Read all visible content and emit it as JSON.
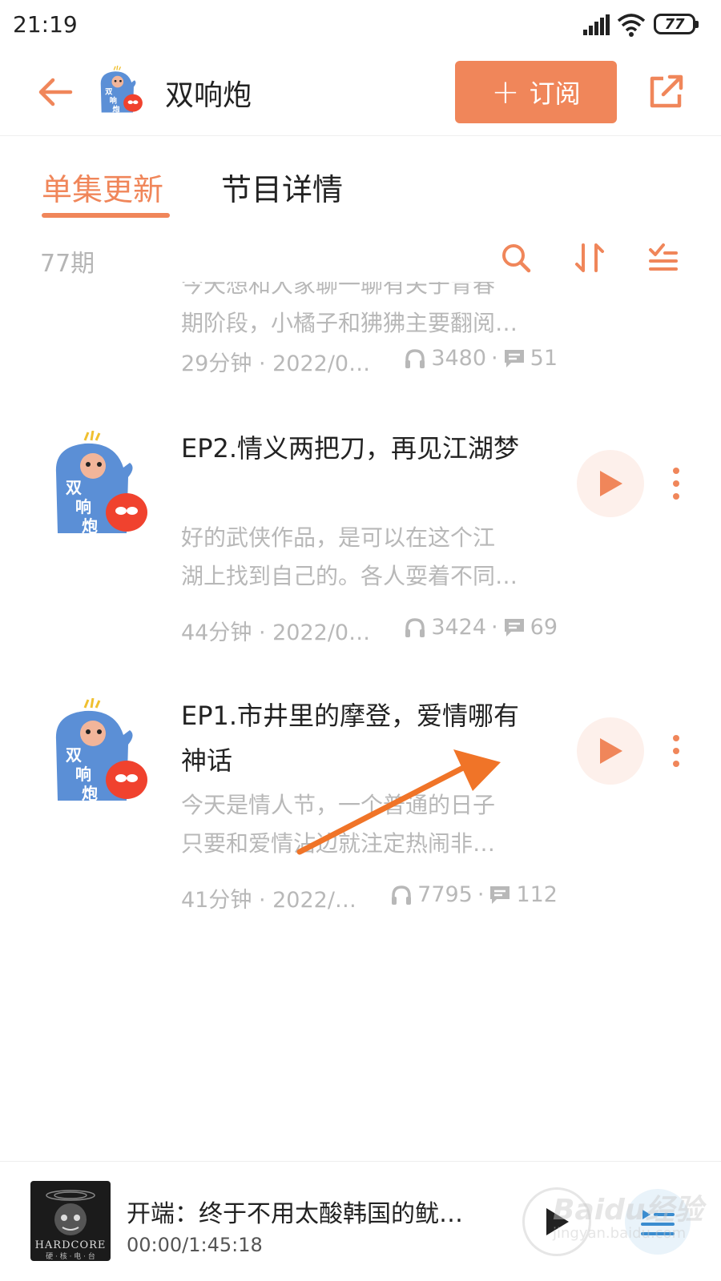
{
  "status_bar": {
    "time": "21:19",
    "battery": "77"
  },
  "header": {
    "title": "双响炮",
    "subscribe_label": "订阅",
    "subscribe_plus": "+"
  },
  "tabs": [
    {
      "label": "单集更新",
      "active": true
    },
    {
      "label": "节目详情",
      "active": false
    }
  ],
  "toolbar": {
    "episode_count": "77期"
  },
  "thumb_text": [
    "双",
    "响",
    "炮"
  ],
  "episodes": [
    {
      "title": "",
      "desc": [
        "今天想和大家聊一聊有关于青春",
        "期阶段，小橘子和狒狒主要翻阅…"
      ],
      "duration_date": "29分钟 · 2022/0…",
      "plays": "3480",
      "comments": "51"
    },
    {
      "title": "EP2.情义两把刀，再见江湖梦",
      "desc": [
        "好的武侠作品，是可以在这个江",
        "湖上找到自己的。各人耍着不同…"
      ],
      "duration_date": "44分钟 · 2022/0…",
      "plays": "3424",
      "comments": "69"
    },
    {
      "title": "EP1.市井里的摩登，爱情哪有神话",
      "desc": [
        "今天是情人节，一个普通的日子",
        "只要和爱情沾边就注定热闹非…"
      ],
      "duration_date": "41分钟 · 2022/…",
      "plays": "7795",
      "comments": "112"
    }
  ],
  "player": {
    "title": "开端：终于不用太酸韩国的鱿…",
    "time": "00:00/1:45:18",
    "cover_text": "HARDCORE",
    "cover_sub": "硬 · 核 · 电 · 台"
  },
  "watermark": {
    "main": "Baidu经验",
    "sub": "jingyan.baidu.com"
  },
  "colors": {
    "accent": "#f0865a",
    "muted": "#b8b8b8",
    "play_bg": "#fdf0eb",
    "thumb_blue": "#5b8fd6",
    "thumb_red": "#f0422e"
  }
}
